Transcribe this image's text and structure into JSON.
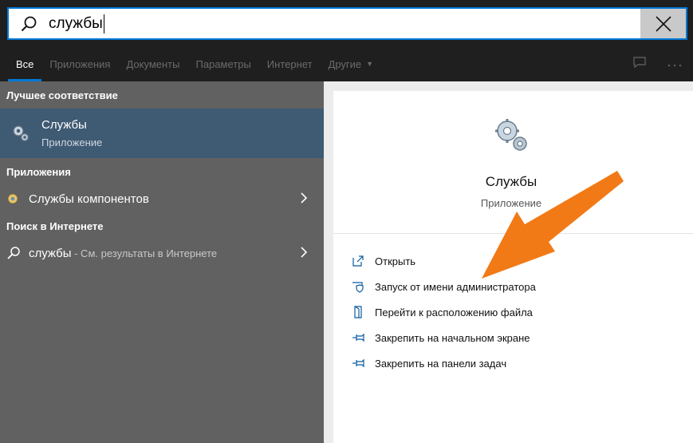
{
  "search": {
    "query": "службы",
    "icon": "search-icon",
    "clear_icon": "close-icon"
  },
  "tabs": [
    {
      "label": "Все",
      "active": true
    },
    {
      "label": "Приложения",
      "active": false
    },
    {
      "label": "Документы",
      "active": false
    },
    {
      "label": "Параметры",
      "active": false
    },
    {
      "label": "Интернет",
      "active": false
    },
    {
      "label": "Другие",
      "active": false,
      "dropdown": true
    }
  ],
  "left": {
    "best_match_header": "Лучшее соответствие",
    "best_match": {
      "title": "Службы",
      "subtitle": "Приложение",
      "icon": "gears-icon"
    },
    "apps_header": "Приложения",
    "apps": [
      {
        "highlight": "Службы",
        "rest": " компонентов",
        "icon": "component-services-icon"
      }
    ],
    "web_header": "Поиск в Интернете",
    "web": {
      "query": "службы",
      "hint": " - См. результаты в Интернете",
      "icon": "search-icon"
    }
  },
  "right": {
    "title": "Службы",
    "subtitle": "Приложение",
    "icon": "gears-icon",
    "actions": [
      {
        "label": "Открыть",
        "icon": "open-icon"
      },
      {
        "label": "Запуск от имени администратора",
        "icon": "shield-icon"
      },
      {
        "label": "Перейти к расположению файла",
        "icon": "file-location-icon"
      },
      {
        "label": "Закрепить на начальном экране",
        "icon": "pin-icon"
      },
      {
        "label": "Закрепить на панели задач",
        "icon": "pin-icon"
      }
    ]
  },
  "colors": {
    "accent": "#0078d7",
    "arrow": "#f27a16",
    "best_match_bg": "#3f5a73"
  }
}
